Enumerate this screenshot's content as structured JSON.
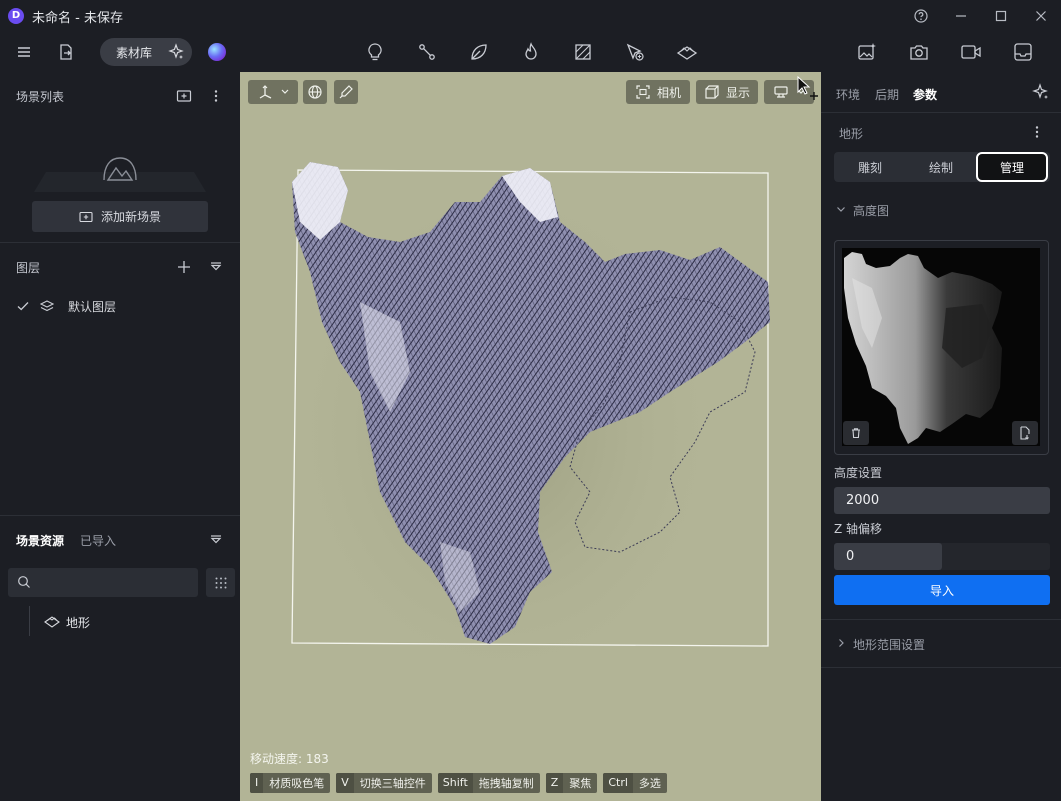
{
  "window": {
    "logo_letter": "D",
    "title": "未命名 - 未保存"
  },
  "toolbar": {
    "library_label": "素材库",
    "center_icons": [
      "lightbulb-icon",
      "path-nodes-icon",
      "leaf-icon",
      "flame-icon",
      "hatch-box-icon",
      "cursor-add-icon",
      "terrain-layer-icon"
    ],
    "right_icons": [
      "image-sparkle-icon",
      "camera-icon",
      "video-icon",
      "inbox-icon"
    ]
  },
  "left_panel": {
    "scene_list_title": "场景列表",
    "add_scene_label": "添加新场景",
    "layers_title": "图层",
    "layers": [
      {
        "name": "默认图层",
        "checked": true
      }
    ],
    "assets_tabs": [
      "场景资源",
      "已导入"
    ],
    "assets_active_tab": 0,
    "search_placeholder": "",
    "assets": [
      {
        "name": "地形"
      }
    ]
  },
  "viewport": {
    "camera_label": "相机",
    "display_label": "显示",
    "speed_text": "移动速度: 183",
    "shortcuts": [
      {
        "key": "I",
        "label": "材质吸色笔"
      },
      {
        "key": "V",
        "label": "切换三轴控件"
      },
      {
        "key": "Shift",
        "label": "拖拽轴复制"
      },
      {
        "key": "Z",
        "label": "聚焦"
      },
      {
        "key": "Ctrl",
        "label": "多选"
      }
    ]
  },
  "right_panel": {
    "tabs": [
      "环境",
      "后期",
      "参数"
    ],
    "active_tab": 2,
    "section_title": "地形",
    "segments": [
      "雕刻",
      "绘制",
      "管理"
    ],
    "active_segment": 2,
    "heightmap_title": "高度图",
    "height_label": "高度设置",
    "height_value": "2000",
    "z_offset_label": "Z 轴偏移",
    "z_offset_value": "0",
    "import_label": "导入",
    "terrain_range_title": "地形范围设置"
  },
  "colors": {
    "accent": "#0f6ff2",
    "viewport_bg": "#b2b496",
    "panel_bg": "#1c1e24"
  }
}
